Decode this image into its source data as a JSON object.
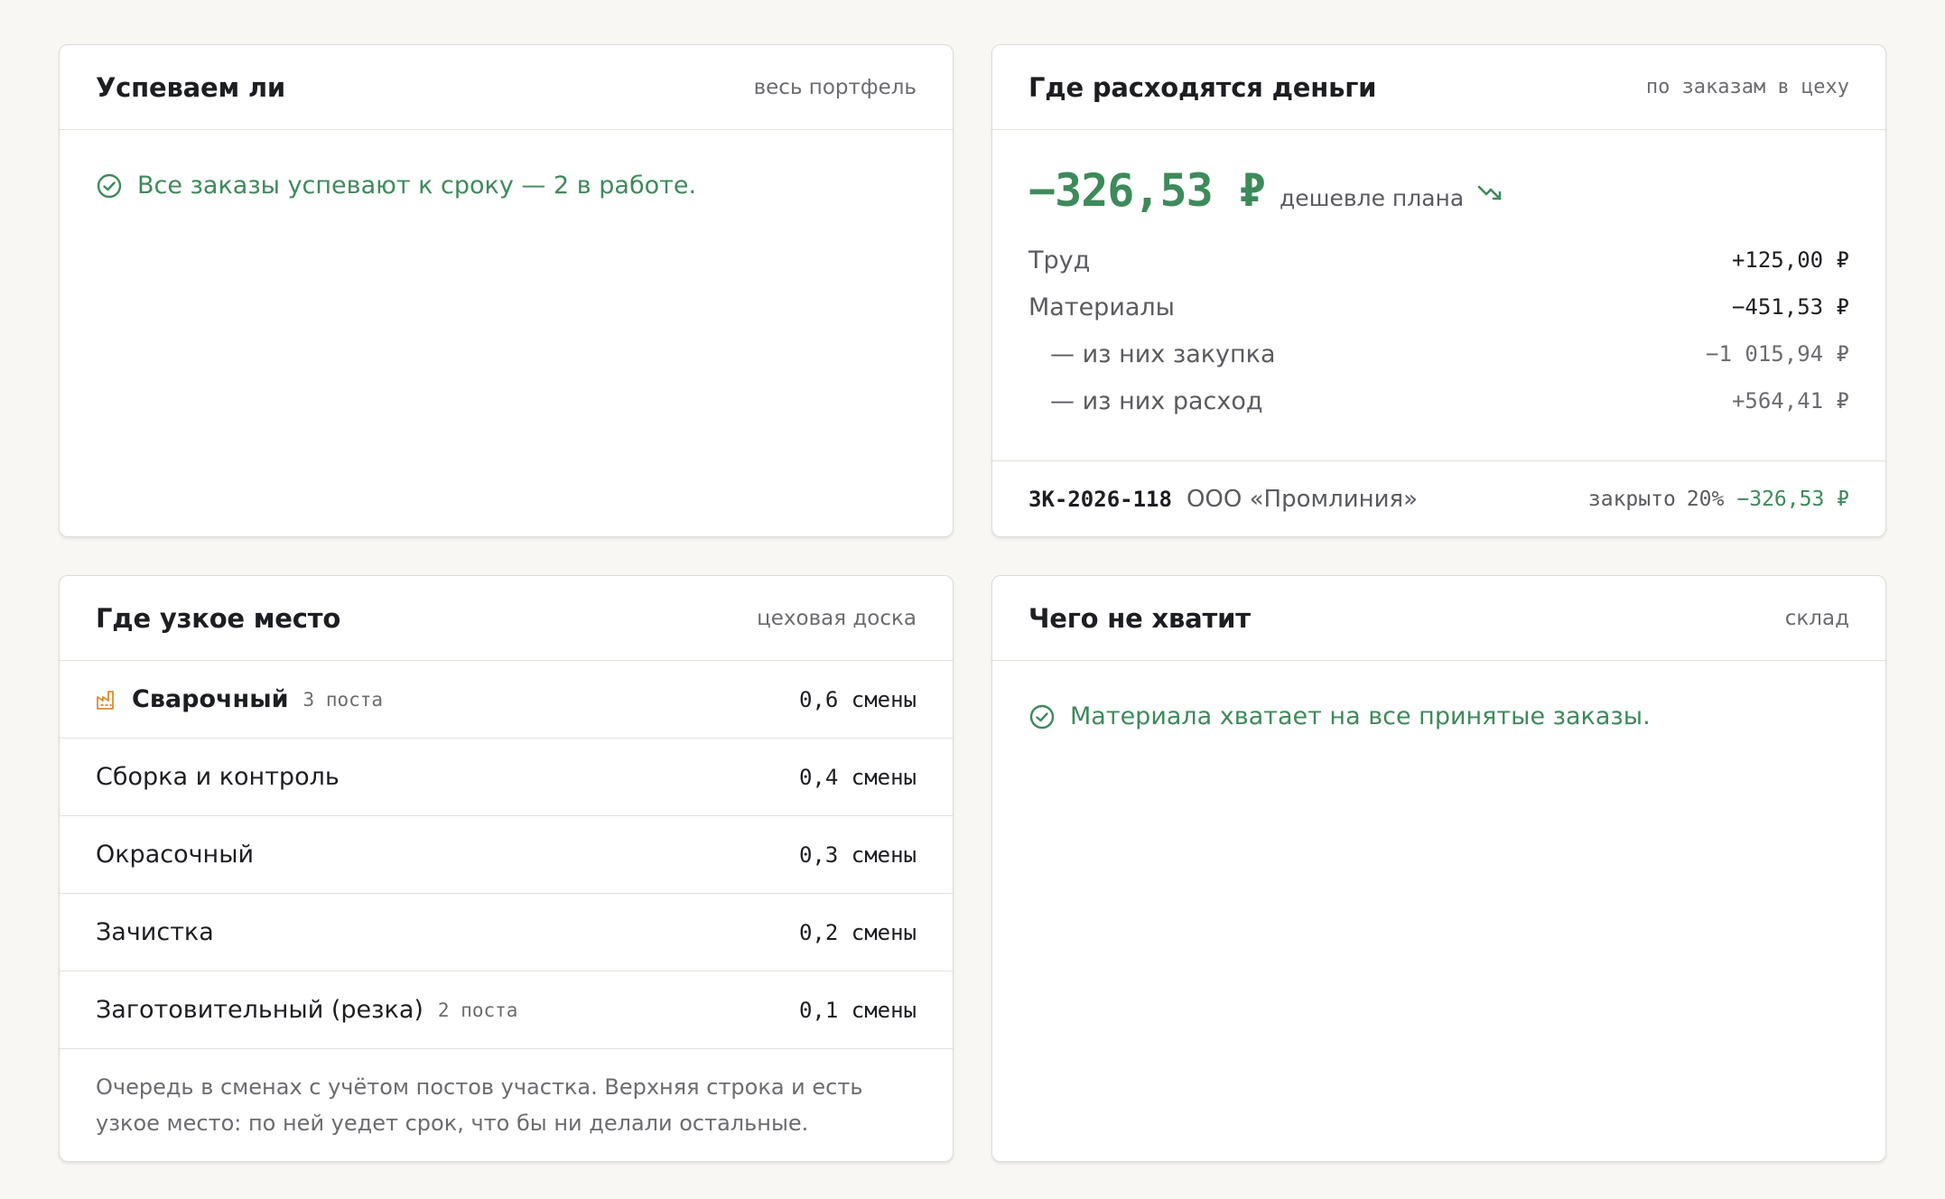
{
  "on_time": {
    "title": "Успеваем ли",
    "subtitle": "весь портфель",
    "status_text": "Все заказы успевают к сроку — 2 в работе."
  },
  "money": {
    "title": "Где расходятся деньги",
    "subtitle": "по заказам в цеху",
    "total": "−326,53 ₽",
    "total_caption": "дешевле плана",
    "trend": "down",
    "breakdown": [
      {
        "label": "Труд",
        "value": "+125,00 ₽"
      },
      {
        "label": "Материалы",
        "value": "−451,53 ₽"
      },
      {
        "label": "— из них закупка",
        "value": "−1 015,94 ₽"
      },
      {
        "label": "— из них расход",
        "value": "+564,41 ₽"
      }
    ],
    "order": {
      "code": "ЗК-2026-118",
      "client": "ООО «Промлиния»",
      "closed_label": "закрыто",
      "closed_pct": "20%",
      "delta": "−326,53 ₽"
    }
  },
  "bottleneck": {
    "title": "Где узкое место",
    "subtitle": "цеховая доска",
    "rows": [
      {
        "name": "Сварочный",
        "posts": "3 поста",
        "value": "0,6 смены"
      },
      {
        "name": "Сборка и контроль",
        "posts": "",
        "value": "0,4 смены"
      },
      {
        "name": "Окрасочный",
        "posts": "",
        "value": "0,3 смены"
      },
      {
        "name": "Зачистка",
        "posts": "",
        "value": "0,2 смены"
      },
      {
        "name": "Заготовительный (резка)",
        "posts": "2 поста",
        "value": "0,1 смены"
      }
    ],
    "note": "Очередь в сменах с учётом постов участка. Верхняя строка и есть узкое место: по ней уедет срок, что бы ни делали остальные."
  },
  "shortage": {
    "title": "Чего не хватит",
    "subtitle": "склад",
    "status_text": "Материала хватает на все принятые заказы."
  },
  "colors": {
    "ok_green": "#3d8a5a",
    "warn_orange": "#e08a2c",
    "background": "#f8f7f3"
  },
  "icons": {
    "ok": "check-circle-icon",
    "trend": "trend-down-icon",
    "bottleneck": "factory-icon"
  }
}
